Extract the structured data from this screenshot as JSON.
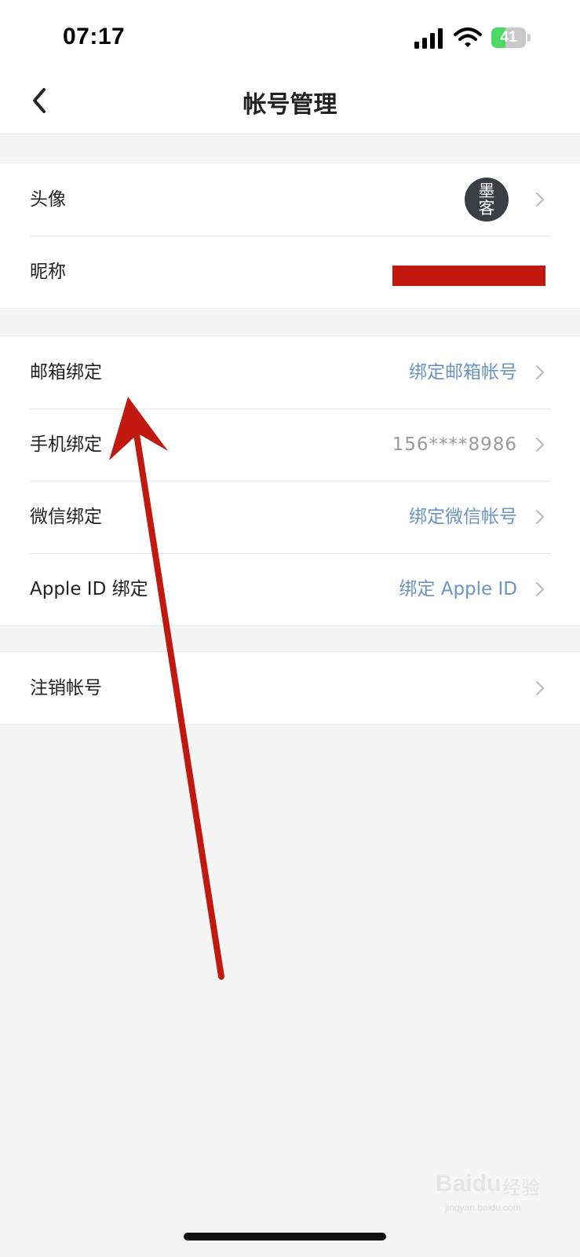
{
  "status_bar": {
    "time": "07:17",
    "battery_level": "41",
    "battery_fraction": 0.41,
    "icons": [
      "cellular-signal-icon",
      "wifi-icon",
      "battery-charging-icon"
    ]
  },
  "nav": {
    "title": "帐号管理",
    "back_icon": "chevron-left-icon"
  },
  "profile": {
    "avatar_label": "头像",
    "avatar_text_top": "墨",
    "avatar_text_bottom": "客",
    "nickname_label": "昵称"
  },
  "bindings": {
    "email_label": "邮箱绑定",
    "email_value": "绑定邮箱帐号",
    "phone_label": "手机绑定",
    "phone_value": "156****8986",
    "wechat_label": "微信绑定",
    "wechat_value": "绑定微信帐号",
    "apple_label": "Apple ID 绑定",
    "apple_value": "绑定 Apple ID"
  },
  "account": {
    "delete_label": "注销帐号"
  },
  "watermark": {
    "brand": "Baidu",
    "brand_cn": "经验",
    "url": "jingyan.baidu.com"
  },
  "colors": {
    "link_blue": "#6b93c5",
    "annotation_red": "#c1180f",
    "battery_green": "#4cd964",
    "background": "#f5f5f5"
  }
}
